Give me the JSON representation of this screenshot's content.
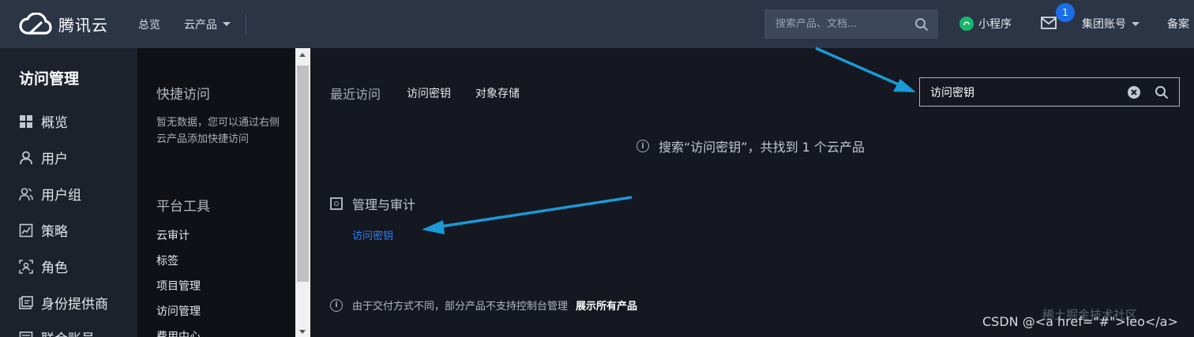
{
  "header": {
    "brand": "腾讯云",
    "nav": [
      {
        "label": "总览"
      },
      {
        "label": "云产品"
      }
    ],
    "search_placeholder": "搜索产品、文档...",
    "miniapp_label": "小程序",
    "mail_badge_count": "1",
    "account_label": "集团账号",
    "beian_label": "备案"
  },
  "sidebar": {
    "title": "访问管理",
    "items": [
      {
        "label": "概览",
        "icon": "grid-icon"
      },
      {
        "label": "用户",
        "icon": "user-icon"
      },
      {
        "label": "用户组",
        "icon": "user-group-icon"
      },
      {
        "label": "策略",
        "icon": "policy-icon"
      },
      {
        "label": "角色",
        "icon": "role-icon"
      },
      {
        "label": "身份提供商",
        "icon": "identity-provider-icon"
      },
      {
        "label": "联合账号",
        "icon": "federated-account-icon"
      }
    ]
  },
  "quick_panel": {
    "quick_access_title": "快捷访问",
    "empty_text": "暂无数据，您可以通过右侧云产品添加快捷访问",
    "tools_title": "平台工具",
    "tools": [
      {
        "label": "云审计"
      },
      {
        "label": "标签"
      },
      {
        "label": "项目管理"
      },
      {
        "label": "访问管理"
      },
      {
        "label": "费用中心"
      }
    ]
  },
  "main": {
    "recent_label": "最近访问",
    "recent_items": [
      {
        "label": "访问密钥"
      },
      {
        "label": "对象存储"
      }
    ],
    "search_value": "访问密钥",
    "result_summary": "搜索“访问密钥”，共找到 1 个云产品",
    "category_title": "管理与审计",
    "result_link": "访问密钥",
    "footnote_text": "由于交付方式不同，部分产品不支持控制台管理",
    "show_all_label": "展示所有产品"
  },
  "watermark": {
    "faint": "稀土掘金技术社区",
    "text": "CSDN @<a href=\"#\">leo</a>"
  },
  "colors": {
    "topbar": "#2b3546",
    "sidebar": "#1d212b",
    "quick_panel": "#0f1116",
    "main_bg": "#151821",
    "link_blue": "#2f7ff5",
    "annotation_arrow": "#1a9ad6",
    "badge_blue": "#1a6fe8",
    "miniapp_green": "#15b86b"
  }
}
